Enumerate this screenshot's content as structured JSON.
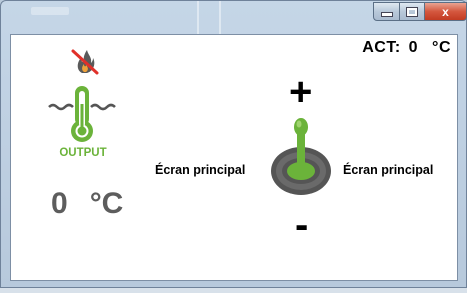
{
  "window": {
    "controls": {
      "minimize_icon": "minimize-icon",
      "maximize_icon": "maximize-icon",
      "close_label": "x"
    }
  },
  "status": {
    "act_label": "ACT:",
    "act_value": "0",
    "act_unit": "°C"
  },
  "heater": {
    "flame_icon": "flame-off-icon",
    "thermometer_icon": "thermometer-icon",
    "output_label": "OUTPUT",
    "temp_value": "0",
    "temp_unit": "°C"
  },
  "joystick": {
    "plus_label": "+",
    "minus_label": "-",
    "left_label": "Écran principal",
    "right_label": "Écran principal",
    "icon": "joystick-icon"
  },
  "colors": {
    "accent_green": "#6bb33a",
    "temp_gray": "#5d5d5d",
    "joystick_dark": "#555555",
    "close_red": "#c23b22"
  }
}
